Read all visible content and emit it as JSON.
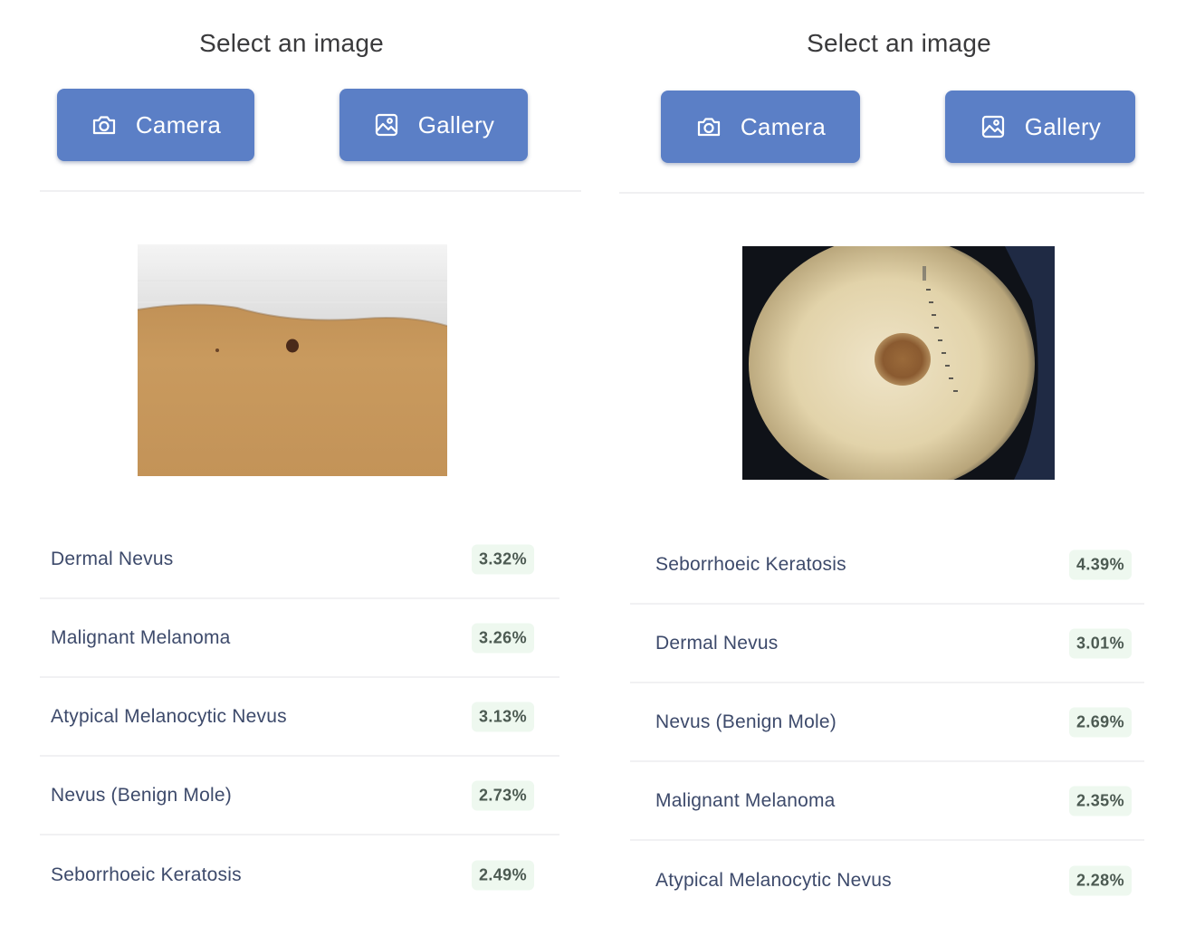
{
  "panels": [
    {
      "title": "Select an image",
      "camera_label": "Camera",
      "gallery_label": "Gallery",
      "photo_icon": "skin-mole-photo",
      "results": [
        {
          "label": "Dermal Nevus",
          "value": "3.32%"
        },
        {
          "label": "Malignant Melanoma",
          "value": "3.26%"
        },
        {
          "label": "Atypical Melanocytic Nevus",
          "value": "3.13%"
        },
        {
          "label": "Nevus (Benign Mole)",
          "value": "2.73%"
        },
        {
          "label": "Seborrhoeic Keratosis",
          "value": "2.49%"
        }
      ]
    },
    {
      "title": "Select an image",
      "camera_label": "Camera",
      "gallery_label": "Gallery",
      "photo_icon": "dermoscopy-photo",
      "results": [
        {
          "label": "Seborrhoeic Keratosis",
          "value": "4.39%"
        },
        {
          "label": "Dermal Nevus",
          "value": "3.01%"
        },
        {
          "label": "Nevus (Benign Mole)",
          "value": "2.69%"
        },
        {
          "label": "Malignant Melanoma",
          "value": "2.35%"
        },
        {
          "label": "Atypical Melanocytic Nevus",
          "value": "2.28%"
        }
      ]
    }
  ],
  "colors": {
    "button_bg": "#5b7fc6",
    "button_text": "#ffffff",
    "label_text": "#3d4a6b",
    "value_bg": "#eef8ef"
  },
  "icons": {
    "camera": "camera-icon",
    "gallery": "image-icon"
  }
}
